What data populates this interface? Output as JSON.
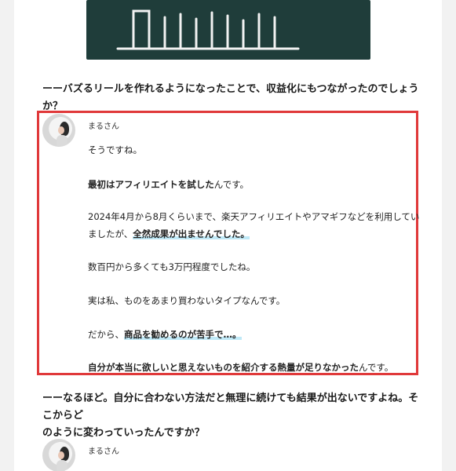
{
  "question1": "ーーバズるリールを作れるようになったことで、収益化にもつながったのでしょうか？",
  "answer": {
    "speaker": "まるさん",
    "p1": "そうですね。",
    "p2_bold": "最初はアフィリエイトを試した",
    "p2_rest": "んです。",
    "p3_line1": "2024年4月から8月くらいまで、楽天アフィリエイトやアマギフなどを利用してい",
    "p3_line2_pre": "ましたが、",
    "p3_line2_bold": "全然成果が出ませんでした。",
    "p4": "数百円から多くても3万円程度でしたね。",
    "p5": "実は私、ものをあまり買わないタイプなんです。",
    "p6_pre": "だから、",
    "p6_bold": "商品を勧めるのが苦手で…。",
    "p7_bold": "自分が本当に欲しいと思えないものを紹介する熱量が足りなかった",
    "p7_rest": "んです。"
  },
  "question2_line1": "ーーなるほど。自分に合わない方法だと無理に続けても結果が出ないですよね。そこからど",
  "question2_line2": "のように変わっていったんですか？",
  "next": {
    "speaker": "まるさん"
  },
  "colors": {
    "highlight_border": "#e0393a",
    "marker": "#bfe9f7",
    "chalkboard": "#1f3d3a"
  }
}
